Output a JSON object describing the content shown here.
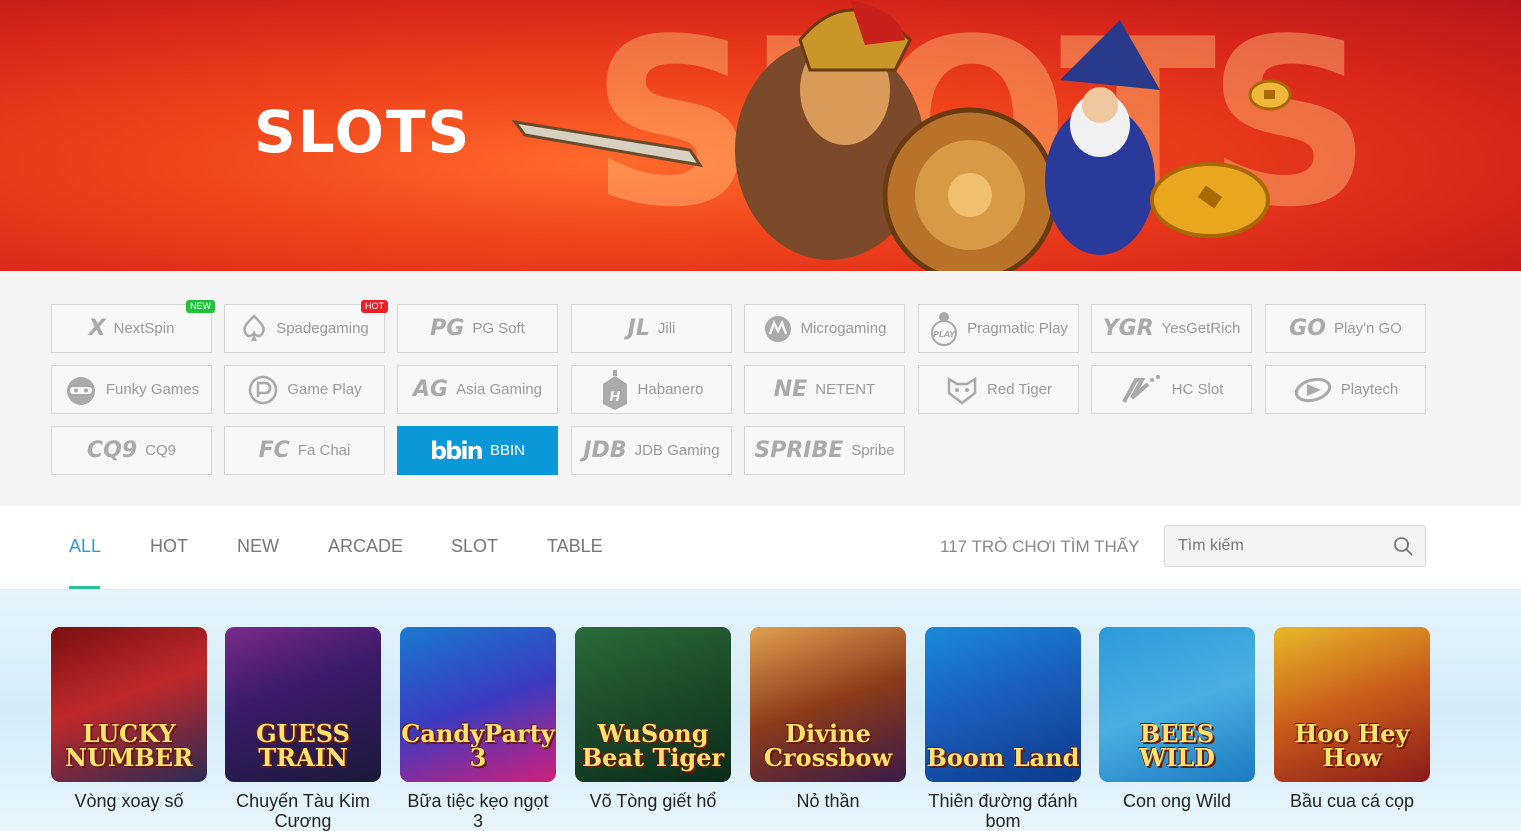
{
  "banner": {
    "title": "SLOTS",
    "bg_word": "SLOTS"
  },
  "providers": [
    {
      "name": "NextSpin",
      "logo": "X",
      "tag": "NEW"
    },
    {
      "name": "Spadegaming",
      "logo": "spade-icon",
      "tag": "HOT"
    },
    {
      "name": "PG Soft",
      "logo": "PG"
    },
    {
      "name": "Jili",
      "logo": "JL"
    },
    {
      "name": "Microgaming",
      "logo": "microgaming-icon"
    },
    {
      "name": "Pragmatic Play",
      "logo": "pragmatic-icon"
    },
    {
      "name": "YesGetRich",
      "logo": "YGR"
    },
    {
      "name": "Play'n GO",
      "logo": "GO"
    },
    {
      "name": "Funky Games",
      "logo": "funky-icon"
    },
    {
      "name": "Game Play",
      "logo": "gameplay-icon"
    },
    {
      "name": "Asia Gaming",
      "logo": "AG"
    },
    {
      "name": "Habanero",
      "logo": "habanero-icon"
    },
    {
      "name": "NETENT",
      "logo": "NE"
    },
    {
      "name": "Red Tiger",
      "logo": "redtiger-icon"
    },
    {
      "name": "HC Slot",
      "logo": "hcslot-icon"
    },
    {
      "name": "Playtech",
      "logo": "playtech-icon"
    },
    {
      "name": "CQ9",
      "logo": "CQ9"
    },
    {
      "name": "Fa Chai",
      "logo": "FC"
    },
    {
      "name": "BBIN",
      "logo": "bbin",
      "active": true
    },
    {
      "name": "JDB Gaming",
      "logo": "JDB"
    },
    {
      "name": "Spribe",
      "logo": "SPRIBE"
    }
  ],
  "tabs": [
    "ALL",
    "HOT",
    "NEW",
    "ARCADE",
    "SLOT",
    "TABLE"
  ],
  "active_tab": "ALL",
  "found_text": "117 TRÒ CHƠI TÌM THẤY",
  "search": {
    "placeholder": "Tìm kiếm"
  },
  "games": [
    {
      "name": "Vòng xoay số",
      "art": "LUCKY NUMBER"
    },
    {
      "name": "Chuyến Tàu Kim Cương",
      "art": "GUESS TRAIN"
    },
    {
      "name": "Bữa tiệc kẹo ngọt 3",
      "art": "CandyParty 3"
    },
    {
      "name": "Võ Tòng giết hổ",
      "art": "WuSong Beat Tiger"
    },
    {
      "name": "Nỏ thần",
      "art": "Divine Crossbow"
    },
    {
      "name": "Thiên đường đánh bom",
      "art": "Boom Land"
    },
    {
      "name": "Con ong Wild",
      "art": "BEES WILD"
    },
    {
      "name": "Bầu cua cá cọp",
      "art": "Hoo Hey How"
    }
  ],
  "colors": {
    "accent": "#0a98d8",
    "tab_active": "#2b9bd8",
    "underline": "#2ac39c",
    "new_tag": "#1fc23a",
    "hot_tag": "#e8202a"
  }
}
